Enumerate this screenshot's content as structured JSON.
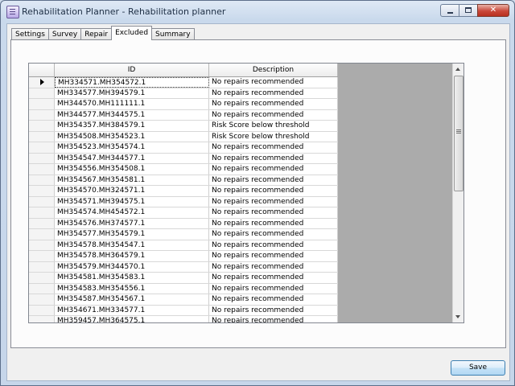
{
  "window": {
    "title": "Rehabilitation Planner - Rehabilitation planner",
    "icon": "app-form-icon"
  },
  "tabs": [
    {
      "label": "Settings",
      "active": false
    },
    {
      "label": "Survey",
      "active": false
    },
    {
      "label": "Repair",
      "active": false
    },
    {
      "label": "Excluded",
      "active": true
    },
    {
      "label": "Summary",
      "active": false
    }
  ],
  "grid": {
    "columns": [
      "ID",
      "Description"
    ],
    "rows": [
      {
        "id": "MH334571.MH354572.1",
        "description": "No repairs recommended"
      },
      {
        "id": "MH334577.MH394579.1",
        "description": "No repairs recommended"
      },
      {
        "id": "MH344570.MH111111.1",
        "description": "No repairs recommended"
      },
      {
        "id": "MH344577.MH344575.1",
        "description": "No repairs recommended"
      },
      {
        "id": "MH354357.MH384579.1",
        "description": "Risk Score below threshold"
      },
      {
        "id": "MH354508.MH354523.1",
        "description": "Risk Score below threshold"
      },
      {
        "id": "MH354523.MH354574.1",
        "description": "No repairs recommended"
      },
      {
        "id": "MH354547.MH344577.1",
        "description": "No repairs recommended"
      },
      {
        "id": "MH354556.MH354508.1",
        "description": "No repairs recommended"
      },
      {
        "id": "MH354567.MH354581.1",
        "description": "No repairs recommended"
      },
      {
        "id": "MH354570.MH324571.1",
        "description": "No repairs recommended"
      },
      {
        "id": "MH354571.MH394575.1",
        "description": "No repairs recommended"
      },
      {
        "id": "MH354574.MH454572.1",
        "description": "No repairs recommended"
      },
      {
        "id": "MH354576.MH374577.1",
        "description": "No repairs recommended"
      },
      {
        "id": "MH354577.MH354579.1",
        "description": "No repairs recommended"
      },
      {
        "id": "MH354578.MH354547.1",
        "description": "No repairs recommended"
      },
      {
        "id": "MH354578.MH364579.1",
        "description": "No repairs recommended"
      },
      {
        "id": "MH354579.MH344570.1",
        "description": "No repairs recommended"
      },
      {
        "id": "MH354581.MH354583.1",
        "description": "No repairs recommended"
      },
      {
        "id": "MH354583.MH354556.1",
        "description": "No repairs recommended"
      },
      {
        "id": "MH354587.MH354567.1",
        "description": "No repairs recommended"
      },
      {
        "id": "MH354671.MH334577.1",
        "description": "No repairs recommended"
      },
      {
        "id": "MH359457.MH364575.1",
        "description": "No repairs recommended"
      }
    ],
    "selected_row": 0
  },
  "footer": {
    "save_label": "Save"
  }
}
